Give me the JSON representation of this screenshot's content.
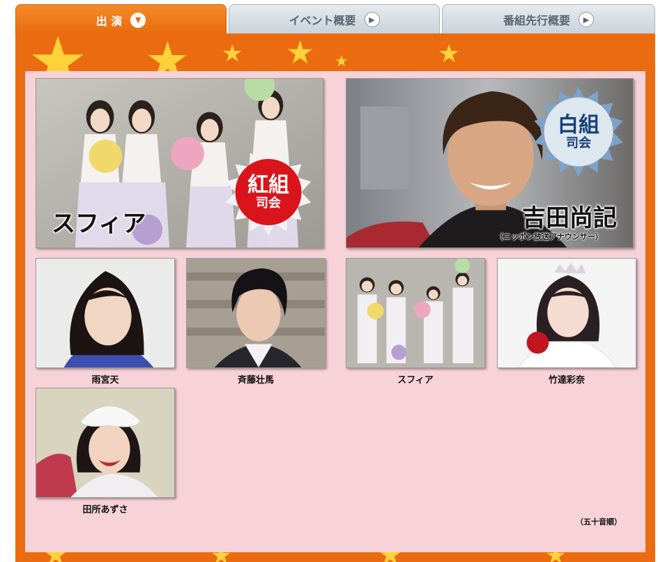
{
  "tabs": [
    {
      "label": "出 演",
      "icon": "chevron-down-icon",
      "active": true
    },
    {
      "label": "イベント概要",
      "icon": "play-arrow-icon",
      "active": false
    },
    {
      "label": "番組先行概要",
      "icon": "play-arrow-icon",
      "active": false
    }
  ],
  "featured": [
    {
      "name": "スフィア",
      "badge_top": "紅組",
      "badge_bottom": "司会"
    },
    {
      "name": "吉田尚記",
      "subtitle": "（ニッポン放送アナウンサー）",
      "badge_top": "白組",
      "badge_bottom": "司会"
    }
  ],
  "cast": [
    {
      "name": "雨宮天"
    },
    {
      "name": "斉藤壮馬"
    },
    {
      "name": "スフィア"
    },
    {
      "name": "竹達彩奈"
    },
    {
      "name": "田所あずさ"
    }
  ],
  "note": "（五十音順）",
  "colors": {
    "frame": "#eb6c10",
    "panel": "#f7d2d8",
    "star": "#ffd23a",
    "red_badge": "#d9141b",
    "white_badge": "#dce7f0"
  }
}
